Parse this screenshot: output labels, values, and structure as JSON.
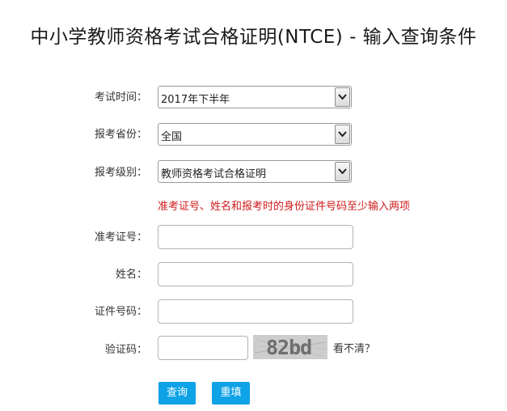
{
  "page": {
    "title": "中小学教师资格考试合格证明(NTCE) - 输入查询条件"
  },
  "form": {
    "exam_time": {
      "label": "考试时间：",
      "value": "2017年下半年"
    },
    "province": {
      "label": "报考省份：",
      "value": "全国"
    },
    "level": {
      "label": "报考级别：",
      "value": "教师资格考试合格证明"
    },
    "notice": "准考证号、姓名和报考时的身份证件号码至少输入两项",
    "ticket_no": {
      "label": "准考证号：",
      "value": ""
    },
    "name": {
      "label": "姓名：",
      "value": ""
    },
    "id_no": {
      "label": "证件号码：",
      "value": ""
    },
    "captcha": {
      "label": "验证码：",
      "value": "",
      "image_text": "82bd",
      "refresh_text": "看不清？"
    }
  },
  "buttons": {
    "query": "查询",
    "reset": "重填"
  },
  "colors": {
    "notice": "#d0191b",
    "button": "#0ea2e7"
  }
}
